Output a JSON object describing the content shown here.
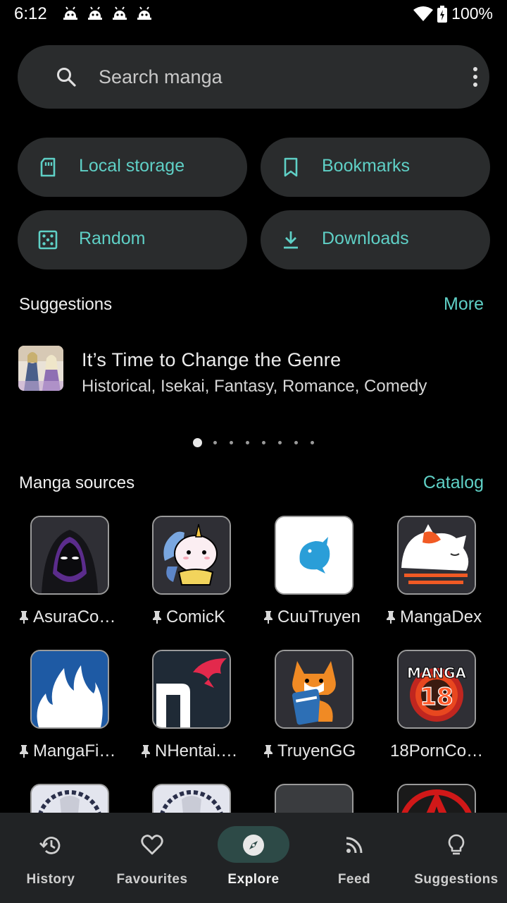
{
  "status": {
    "time": "6:12",
    "battery": "100%"
  },
  "search": {
    "placeholder": "Search manga"
  },
  "quick_actions": [
    {
      "label": "Local storage",
      "icon": "sd-card-icon"
    },
    {
      "label": "Bookmarks",
      "icon": "bookmark-icon"
    },
    {
      "label": "Random",
      "icon": "dice-icon"
    },
    {
      "label": "Downloads",
      "icon": "download-icon"
    }
  ],
  "suggestions": {
    "header": "Suggestions",
    "more_label": "More",
    "item": {
      "title": "It’s Time to Change the Genre",
      "genres": "Historical, Isekai, Fantasy, Romance, Comedy"
    },
    "page_count": 8,
    "active_page": 1
  },
  "sources": {
    "header": "Manga sources",
    "catalog_label": "Catalog",
    "items": [
      {
        "name": "AsuraCo…",
        "pinned": true
      },
      {
        "name": "ComicK",
        "pinned": true
      },
      {
        "name": "CuuTruyen",
        "pinned": true
      },
      {
        "name": "MangaDex",
        "pinned": true
      },
      {
        "name": "MangaFi…",
        "pinned": true
      },
      {
        "name": "NHentai.…",
        "pinned": true
      },
      {
        "name": "TruyenGG",
        "pinned": true
      },
      {
        "name": "18PornCo…",
        "pinned": false
      }
    ],
    "logo_texts": {
      "manga18_top": "MANGA",
      "manga18_bottom": "18"
    }
  },
  "bottom_nav": {
    "items": [
      {
        "label": "History",
        "icon": "history-icon"
      },
      {
        "label": "Favourites",
        "icon": "heart-icon"
      },
      {
        "label": "Explore",
        "icon": "compass-icon",
        "active": true
      },
      {
        "label": "Feed",
        "icon": "rss-icon"
      },
      {
        "label": "Suggestions",
        "icon": "lightbulb-icon"
      }
    ]
  },
  "colors": {
    "accent": "#5fd0c6",
    "surface": "#2a2c2d",
    "nav_bg": "#212325",
    "active_pill": "#2d4a47"
  }
}
